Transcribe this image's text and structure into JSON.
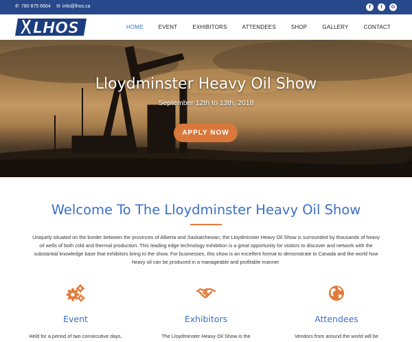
{
  "topbar": {
    "phone": "780 875 6664",
    "email": "info@lhos.ca",
    "social": [
      {
        "icon": "facebook-icon",
        "glyph": "f"
      },
      {
        "icon": "twitter-icon",
        "glyph": "t"
      },
      {
        "icon": "google-plus-icon",
        "glyph": "G"
      }
    ]
  },
  "logo_text": "LHOS",
  "nav": [
    "HOME",
    "EVENT",
    "EXHIBITORS",
    "ATTENDEES",
    "SHOP",
    "GALLERY",
    "CONTACT"
  ],
  "hero": {
    "title": "Lloydminster Heavy Oil Show",
    "subtitle": "September 12th to 13th, 2018",
    "cta": "APPLY NOW"
  },
  "welcome": {
    "title": "Welcome To The Lloydminster Heavy Oil Show",
    "lines": [
      "Uniquely situated on the border between the provinces of Alberta and Saskatchewan, the Lloydminster Heavy Oil Show is surrounded by thousands of heavy",
      "oil wells of both cold and thermal production. This leading edge technology exhibition is a great opportunity for visitors to discover and network with the",
      "substantial knowledge base that exhibitors bring to the show. For businesses, this show is an excellent format to demonstrate to Canada and the world how",
      "heavy oil can be produced in a manageable and profitable manner."
    ]
  },
  "features": [
    {
      "title": "Event",
      "text": "Held for a period of two consecutive days,",
      "icon": "gears-icon"
    },
    {
      "title": "Exhibitors",
      "text": "The Lloydminster Heavy Oil Show is the",
      "icon": "handshake-icon"
    },
    {
      "title": "Attendees",
      "text": "Vendors from around the world will be",
      "icon": "globe-icon"
    }
  ],
  "colors": {
    "topbar": "#27488a",
    "accent": "#3a6fc8",
    "orange": "#e07a3a"
  }
}
